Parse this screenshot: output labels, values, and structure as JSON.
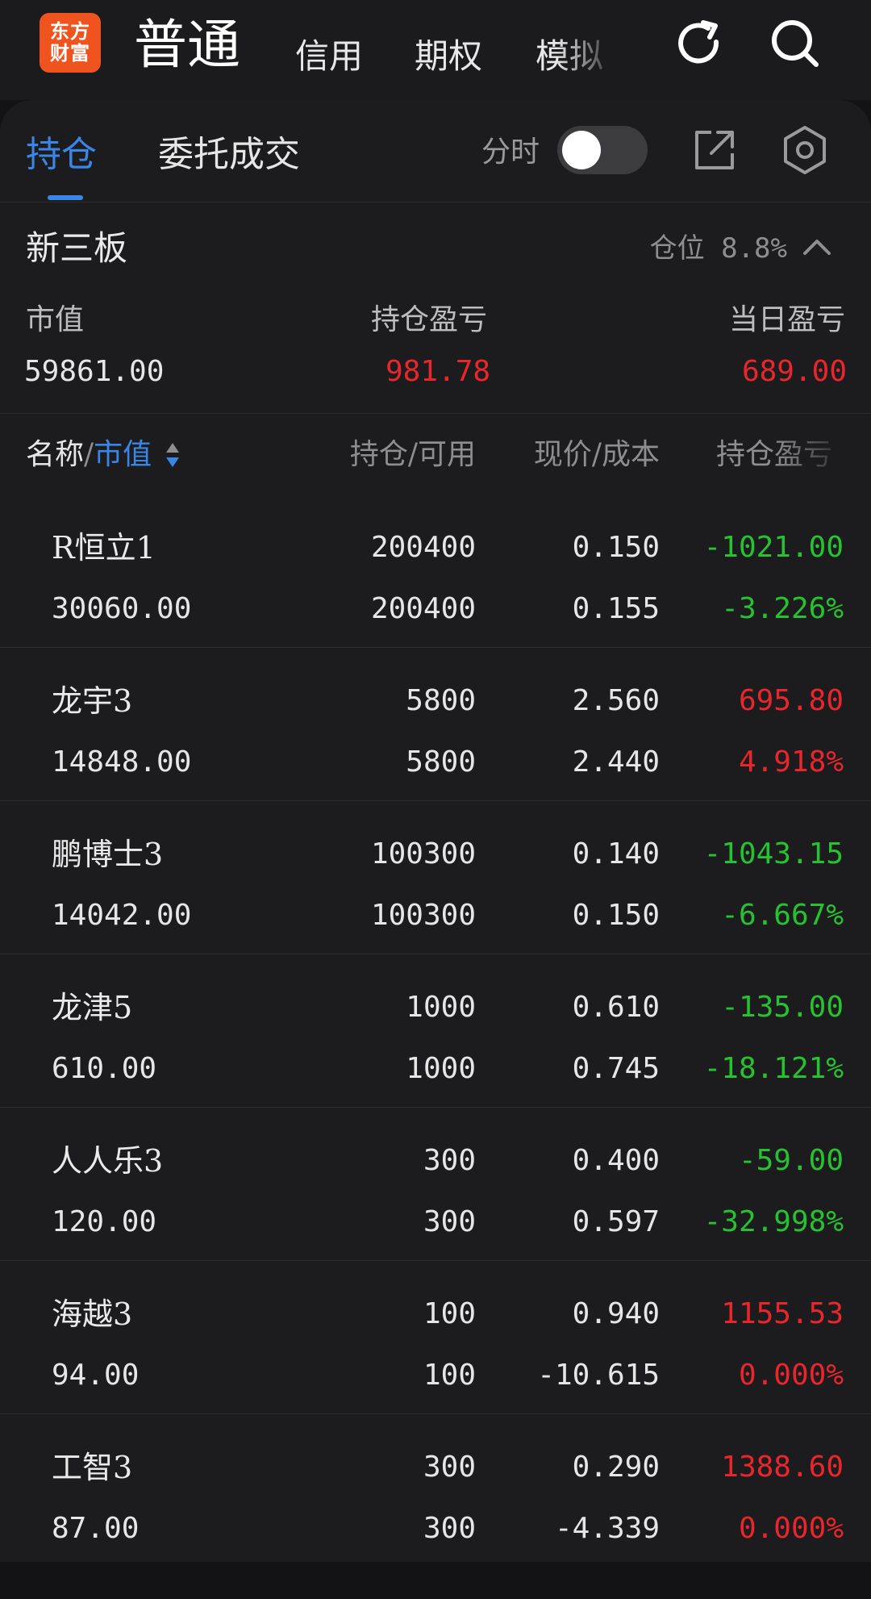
{
  "header": {
    "logo_line1": "东方",
    "logo_line2": "财富",
    "main_tab": "普通",
    "tabs": [
      "信用",
      "期权",
      "模拟"
    ],
    "icons": [
      "refresh-icon",
      "search-icon"
    ]
  },
  "panel": {
    "tabs": [
      {
        "label": "持仓",
        "active": true
      },
      {
        "label": "委托成交",
        "active": false
      }
    ],
    "fenshi_label": "分时",
    "fenshi_on": false,
    "icons": [
      "share-icon",
      "settings-icon"
    ]
  },
  "section": {
    "title": "新三板",
    "position_ratio": "仓位 8.8%",
    "summary": {
      "market_value_label": "市值",
      "market_value": "59861.00",
      "holding_pnl_label": "持仓盈亏",
      "holding_pnl": "981.78",
      "daily_pnl_label": "当日盈亏",
      "daily_pnl": "689.00"
    }
  },
  "table": {
    "header": {
      "name": "名称",
      "separator": "/",
      "sort_col": "市值",
      "qty": "持仓/可用",
      "price": "现价/成本",
      "pnl": "持仓盈亏"
    },
    "rows": [
      {
        "name": "R恒立1",
        "market_value": "30060.00",
        "holding": "200400",
        "available": "200400",
        "price": "0.150",
        "cost": "0.155",
        "pnl": "-1021.00",
        "pnl_pct": "-3.226%",
        "trend": "down"
      },
      {
        "name": "龙宇3",
        "market_value": "14848.00",
        "holding": "5800",
        "available": "5800",
        "price": "2.560",
        "cost": "2.440",
        "pnl": "695.80",
        "pnl_pct": "4.918%",
        "trend": "up"
      },
      {
        "name": "鹏博士3",
        "market_value": "14042.00",
        "holding": "100300",
        "available": "100300",
        "price": "0.140",
        "cost": "0.150",
        "pnl": "-1043.15",
        "pnl_pct": "-6.667%",
        "trend": "down"
      },
      {
        "name": "龙津5",
        "market_value": "610.00",
        "holding": "1000",
        "available": "1000",
        "price": "0.610",
        "cost": "0.745",
        "pnl": "-135.00",
        "pnl_pct": "-18.121%",
        "trend": "down"
      },
      {
        "name": "人人乐3",
        "market_value": "120.00",
        "holding": "300",
        "available": "300",
        "price": "0.400",
        "cost": "0.597",
        "pnl": "-59.00",
        "pnl_pct": "-32.998%",
        "trend": "down"
      },
      {
        "name": "海越3",
        "market_value": "94.00",
        "holding": "100",
        "available": "100",
        "price": "0.940",
        "cost": "-10.615",
        "pnl": "1155.53",
        "pnl_pct": "0.000%",
        "trend": "up"
      },
      {
        "name": "工智3",
        "market_value": "87.00",
        "holding": "300",
        "available": "300",
        "price": "0.290",
        "cost": "-4.339",
        "pnl": "1388.60",
        "pnl_pct": "0.000%",
        "trend": "up"
      }
    ]
  },
  "colors": {
    "accent": "#3a86e6",
    "up": "#e8262b",
    "down": "#27c230",
    "logo": "#f0541e"
  }
}
